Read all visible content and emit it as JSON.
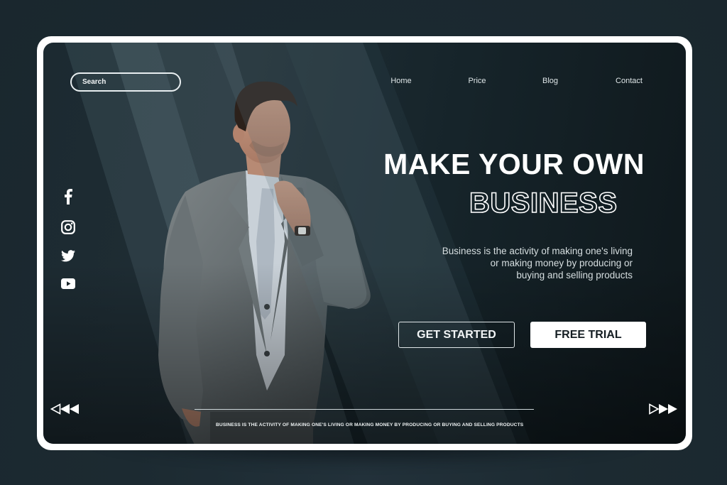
{
  "search": {
    "placeholder": "Search"
  },
  "nav": {
    "items": [
      {
        "label": "Home"
      },
      {
        "label": "Price"
      },
      {
        "label": "Blog"
      },
      {
        "label": "Contact"
      }
    ]
  },
  "hero": {
    "headline_line1": "MAKE YOUR OWN",
    "headline_line2": "BUSINESS",
    "description_lines": [
      "Business is the activity of making one's living",
      "or making money by producing or",
      "buying and selling products"
    ],
    "primary_button": "GET STARTED",
    "secondary_button": "FREE TRIAL"
  },
  "social": {
    "icons": [
      "facebook-icon",
      "instagram-icon",
      "twitter-icon",
      "youtube-icon"
    ]
  },
  "slider": {
    "prev_icon": "rewind-icon",
    "next_icon": "fast-forward-icon"
  },
  "footer": {
    "tagline": "BUSINESS IS THE ACTIVITY OF MAKING ONE'S LIVING OR MAKING MONEY BY PRODUCING OR BUYING AND SELLING PRODUCTS"
  },
  "colors": {
    "background": "#1c2a31",
    "frame": "#ffffff",
    "text": "#ffffff",
    "button_text_dark": "#141d22"
  }
}
